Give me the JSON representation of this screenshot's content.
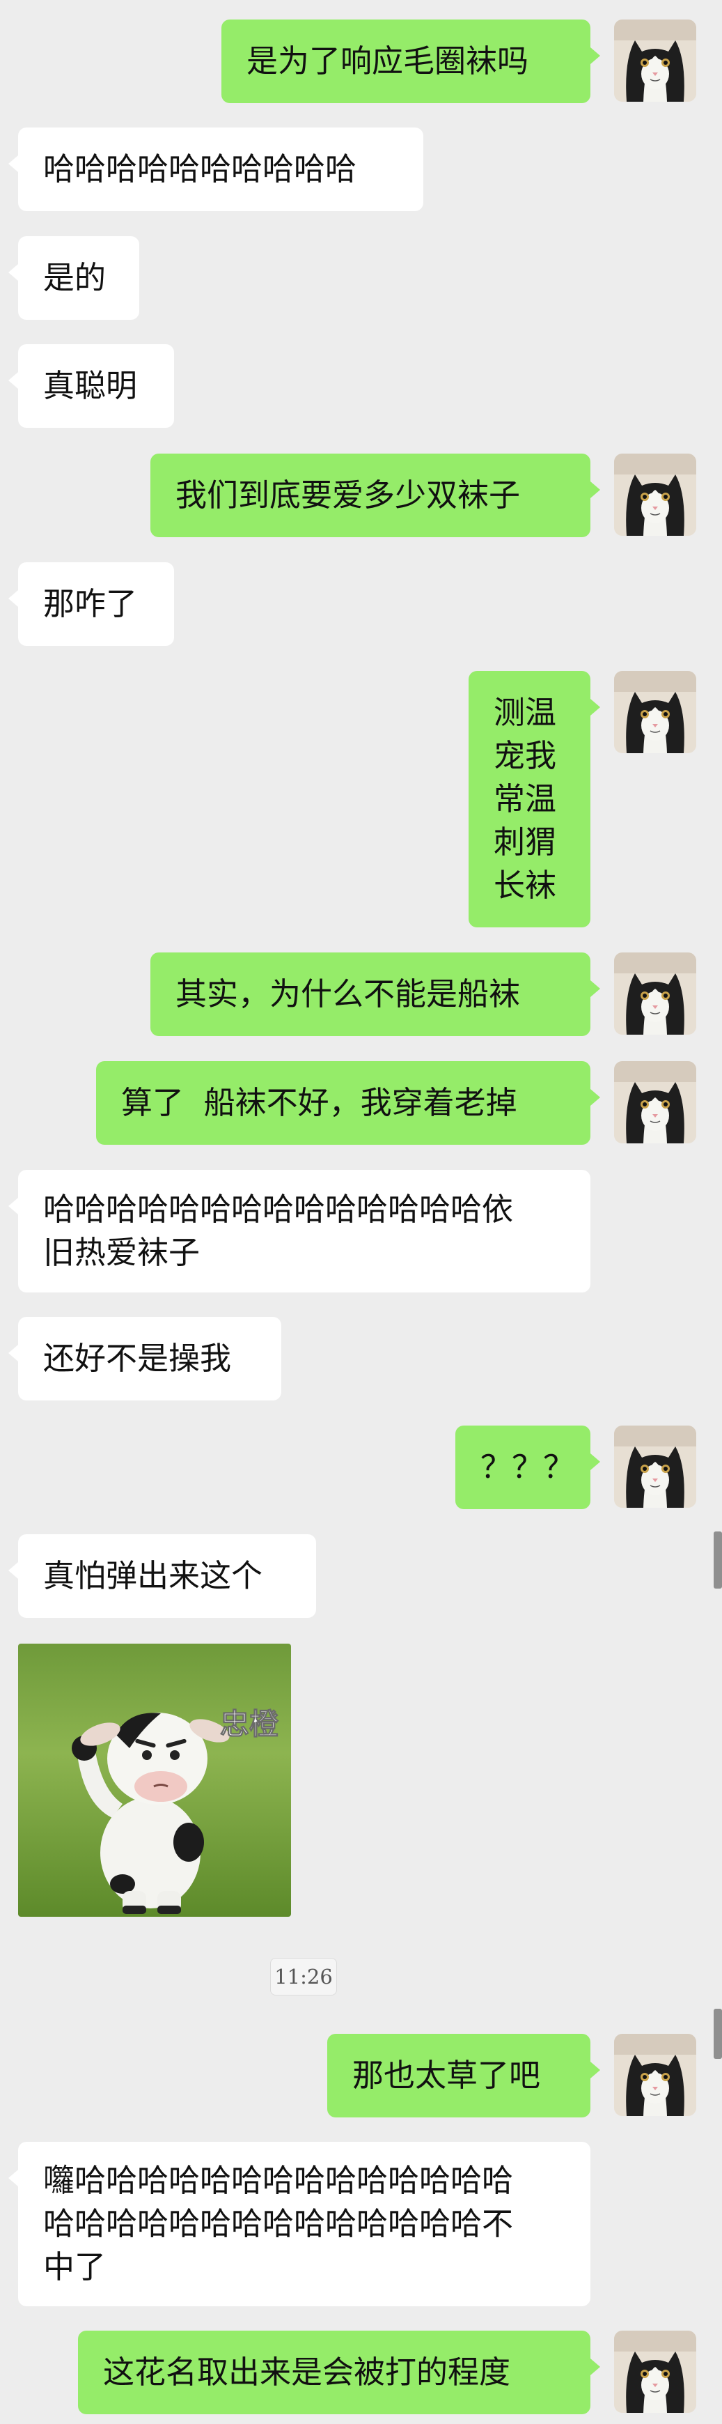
{
  "chat": {
    "messages": [
      {
        "side": "out",
        "text": "是为了响应毛圈袜吗"
      },
      {
        "side": "in",
        "text": "哈哈哈哈哈哈哈哈哈哈"
      },
      {
        "side": "in",
        "text": "是的"
      },
      {
        "side": "in",
        "text": "真聪明"
      },
      {
        "side": "out",
        "text": "我们到底要爱多少双袜子"
      },
      {
        "side": "in",
        "text": "那咋了"
      },
      {
        "side": "out",
        "text": "测温\n宠我\n常温\n刺猬\n长袜"
      },
      {
        "side": "out",
        "text": "其实，为什么不能是船袜"
      },
      {
        "side": "out",
        "text": "算了  船袜不好，我穿着老掉"
      },
      {
        "side": "in",
        "text": "哈哈哈哈哈哈哈哈哈哈哈哈哈哈依\n旧热爱袜子"
      },
      {
        "side": "in",
        "text": "还好不是操我"
      },
      {
        "side": "out",
        "text": "？？？"
      },
      {
        "side": "in",
        "text": "真怕弹出来这个"
      },
      {
        "side": "out",
        "text": "那也太草了吧"
      },
      {
        "side": "in",
        "text": "囖哈哈哈哈哈哈哈哈哈哈哈哈哈哈\n哈哈哈哈哈哈哈哈哈哈哈哈哈哈不\n中了"
      },
      {
        "side": "out",
        "text": "这花名取出来是会被打的程度"
      }
    ],
    "sticker": {
      "caption": "忠橙"
    },
    "timestamp": "11:26"
  },
  "colors": {
    "background": "#ededed",
    "outgoing_bubble": "#95ec69",
    "incoming_bubble": "#ffffff"
  },
  "icons": {
    "avatar": "cat-avatar-icon",
    "sticker": "cow-salute-sticker"
  }
}
